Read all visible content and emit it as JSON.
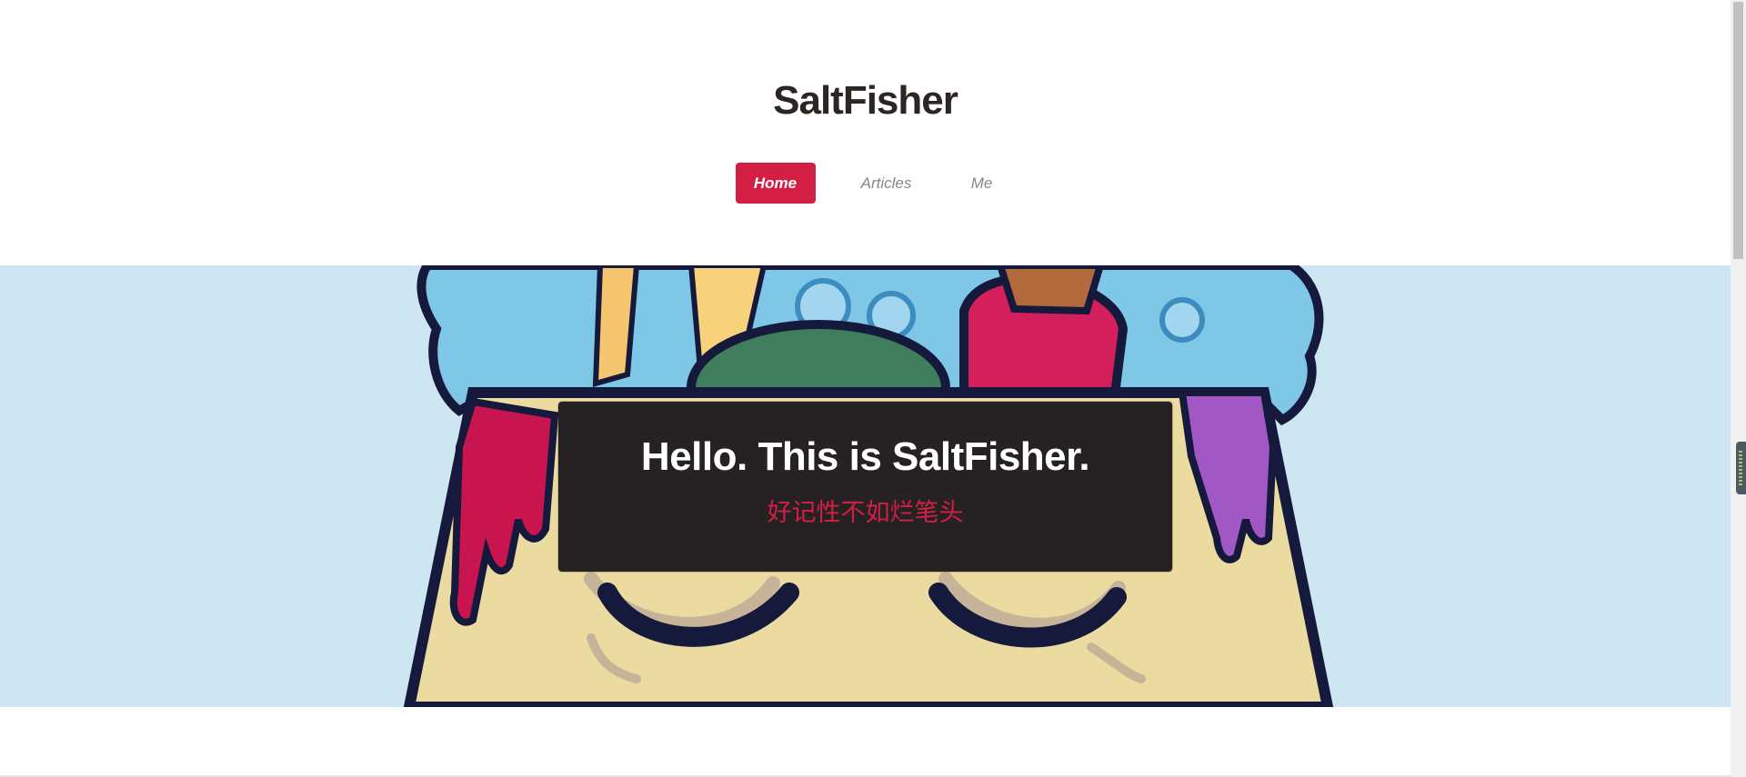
{
  "site": {
    "title": "SaltFisher"
  },
  "nav": {
    "items": [
      {
        "label": "Home",
        "active": true
      },
      {
        "label": "Articles",
        "active": false
      },
      {
        "label": "Me",
        "active": false
      }
    ]
  },
  "hero": {
    "title": "Hello. This is SaltFisher.",
    "subtitle": "好记性不如烂笔头"
  },
  "colors": {
    "accent": "#d31f43",
    "banner_bg": "#cde6f2",
    "hero_box_bg": "#262122",
    "title_text": "#2b2523"
  }
}
